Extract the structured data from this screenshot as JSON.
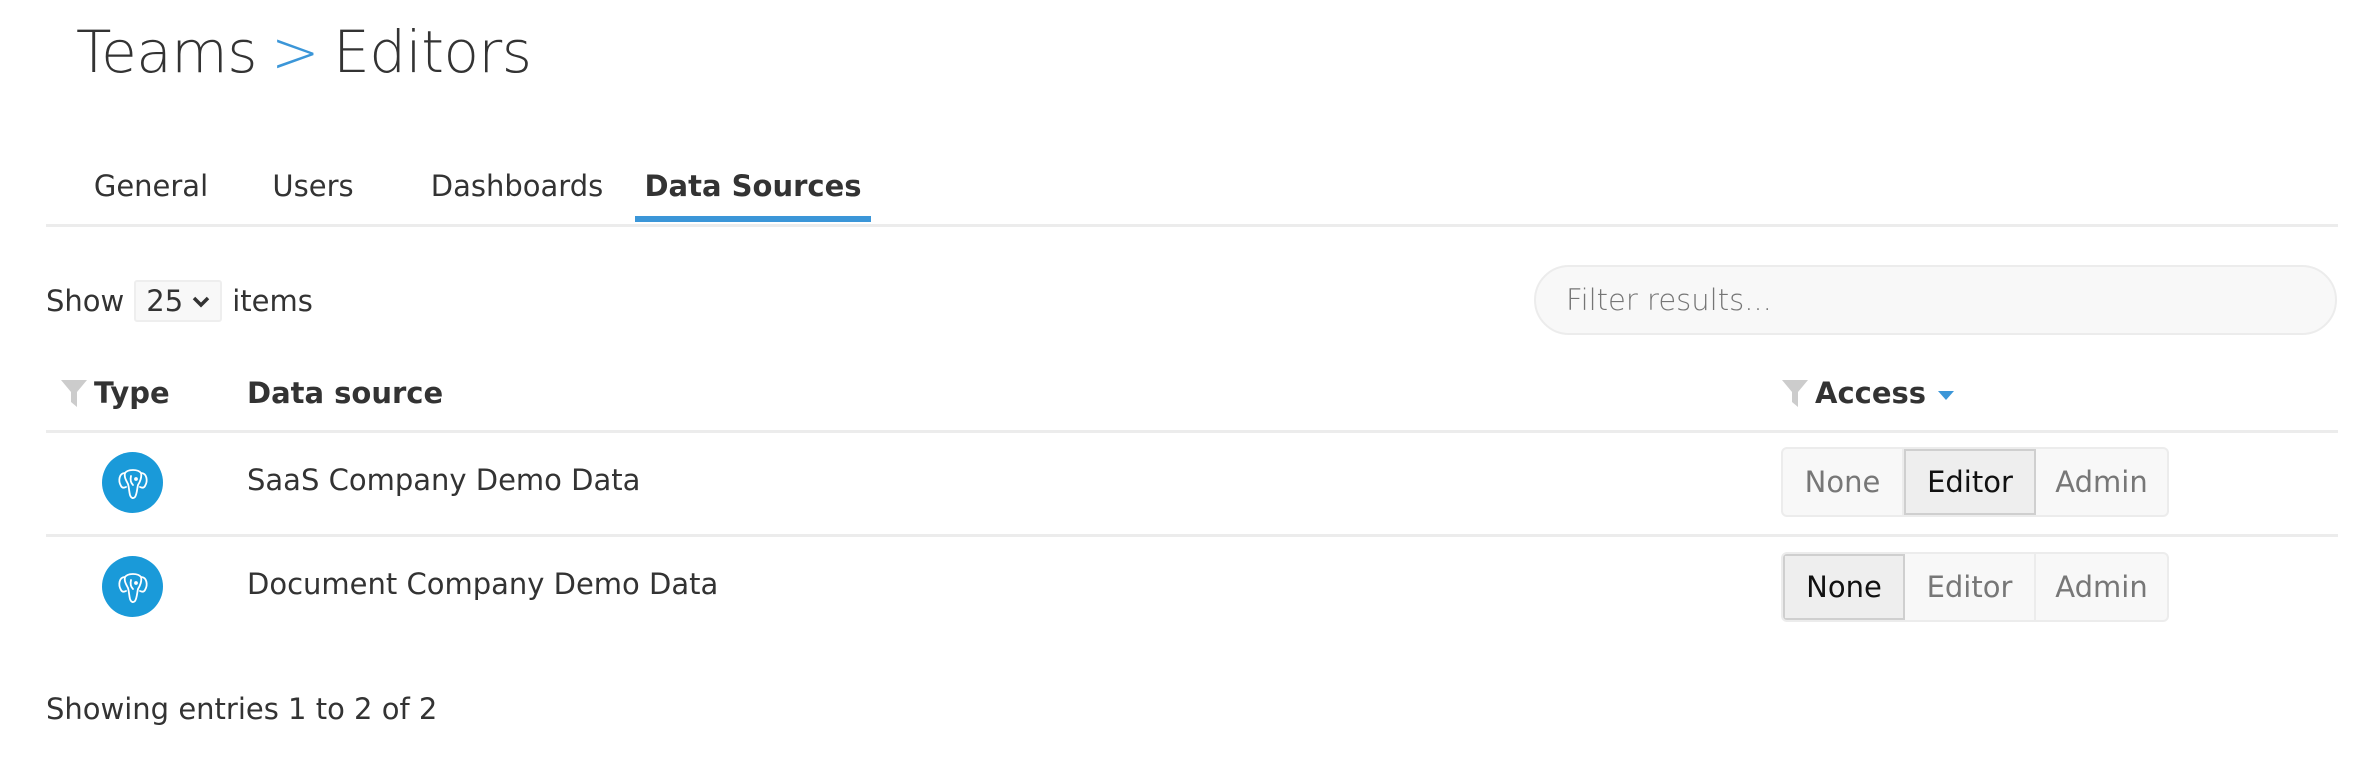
{
  "breadcrumb": {
    "parent": "Teams",
    "separator": ">",
    "current": "Editors"
  },
  "tabs": [
    {
      "label": "General",
      "active": false
    },
    {
      "label": "Users",
      "active": false
    },
    {
      "label": "Dashboards",
      "active": false
    },
    {
      "label": "Data Sources",
      "active": true
    }
  ],
  "page_size": {
    "prefix": "Show",
    "value": "25",
    "suffix": "items"
  },
  "filter": {
    "placeholder": "Filter results...",
    "value": ""
  },
  "table": {
    "columns": [
      {
        "label": "Type",
        "filter_icon": "funnel-icon"
      },
      {
        "label": "Data source"
      },
      {
        "label": "Access",
        "filter_icon": "funnel-icon",
        "sort_icon": "caret-down-icon"
      }
    ],
    "rows": [
      {
        "type_icon": "postgresql-elephant-icon",
        "name": "SaaS Company Demo Data",
        "access_options": [
          "None",
          "Editor",
          "Admin"
        ],
        "access_selected": "Editor"
      },
      {
        "type_icon": "postgresql-elephant-icon",
        "name": "Document Company Demo Data",
        "access_options": [
          "None",
          "Editor",
          "Admin"
        ],
        "access_selected": "None"
      }
    ]
  },
  "footer": {
    "status": "Showing entries 1 to 2 of 2"
  },
  "colors": {
    "accent": "#3b96d8",
    "postgres_icon_bg": "#1a9ad9"
  }
}
